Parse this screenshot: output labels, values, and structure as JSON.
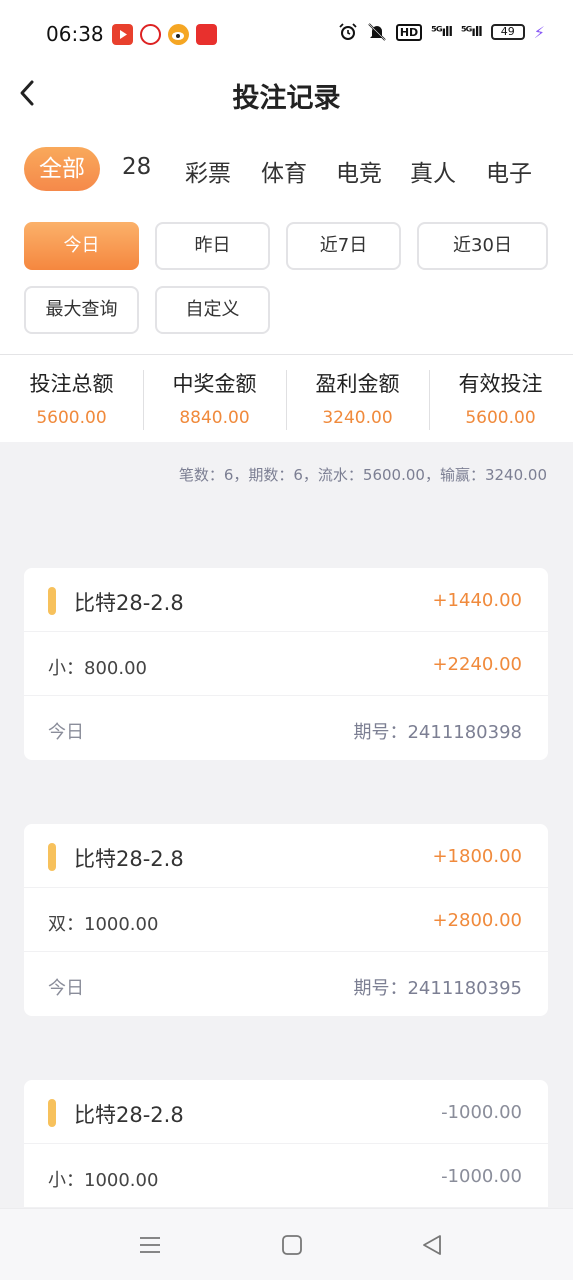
{
  "status_bar": {
    "time": "06:38",
    "hd_label": "HD",
    "sig1_label": "⁵ᴳıll",
    "sig2_label": "⁵ᴳıll",
    "battery": "49",
    "battery_level": 0.49
  },
  "header": {
    "title": "投注记录"
  },
  "categories": [
    "全部",
    "28",
    "彩票",
    "体育",
    "电竞",
    "真人",
    "电子"
  ],
  "date_filters": [
    "今日",
    "昨日",
    "近7日",
    "近30日",
    "最大查询",
    "自定义"
  ],
  "summary": [
    {
      "label": "投注总额",
      "value": "5600.00"
    },
    {
      "label": "中奖金额",
      "value": "8840.00"
    },
    {
      "label": "盈利金额",
      "value": "3240.00"
    },
    {
      "label": "有效投注",
      "value": "5600.00"
    }
  ],
  "stats_line": "笔数：6，期数：6，流水：5600.00，输赢：3240.00",
  "records": [
    {
      "title": "比特28-2.8",
      "profit": "+1440.00",
      "bet": "小：800.00",
      "payout": "+2240.00",
      "date": "今日",
      "issue": "期号：2411180398"
    },
    {
      "title": "比特28-2.8",
      "profit": "+1800.00",
      "bet": "双：1000.00",
      "payout": "+2800.00",
      "date": "今日",
      "issue": "期号：2411180395"
    },
    {
      "title": "比特28-2.8",
      "profit": "-1000.00",
      "bet": "小：1000.00",
      "payout": "-1000.00",
      "date": "",
      "issue": ""
    }
  ],
  "colors": {
    "accent": "#f5894a",
    "value_orange": "#f08a3c",
    "marker": "#f7c15c",
    "muted": "#8a8d9a"
  }
}
